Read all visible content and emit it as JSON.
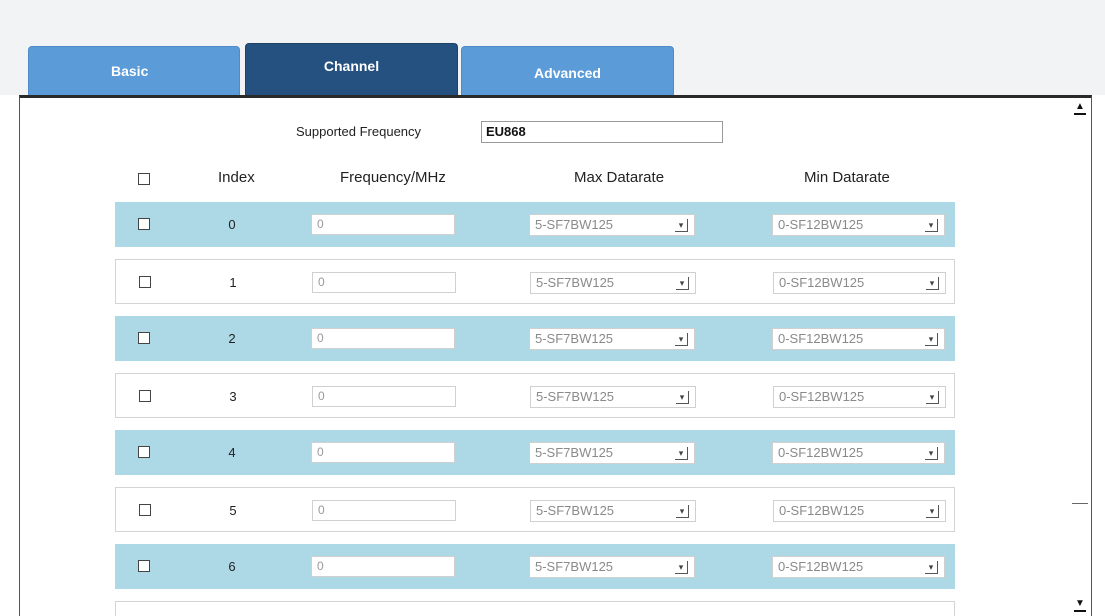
{
  "tabs": [
    {
      "label": "Basic"
    },
    {
      "label": "Channel"
    },
    {
      "label": "Advanced"
    }
  ],
  "supported_frequency": {
    "label": "Supported Frequency",
    "value": "EU868"
  },
  "table": {
    "headers": {
      "index": "Index",
      "frequency": "Frequency/MHz",
      "max": "Max Datarate",
      "min": "Min Datarate"
    },
    "rows": [
      {
        "index": "0",
        "frequency": "0",
        "max": "5-SF7BW125",
        "min": "0-SF12BW125"
      },
      {
        "index": "1",
        "frequency": "0",
        "max": "5-SF7BW125",
        "min": "0-SF12BW125"
      },
      {
        "index": "2",
        "frequency": "0",
        "max": "5-SF7BW125",
        "min": "0-SF12BW125"
      },
      {
        "index": "3",
        "frequency": "0",
        "max": "5-SF7BW125",
        "min": "0-SF12BW125"
      },
      {
        "index": "4",
        "frequency": "0",
        "max": "5-SF7BW125",
        "min": "0-SF12BW125"
      },
      {
        "index": "5",
        "frequency": "0",
        "max": "5-SF7BW125",
        "min": "0-SF12BW125"
      },
      {
        "index": "6",
        "frequency": "0",
        "max": "5-SF7BW125",
        "min": "0-SF12BW125"
      }
    ]
  },
  "colors": {
    "tab_inactive": "#5b9bd8",
    "tab_active": "#24517f",
    "row_shade": "#add8e6"
  },
  "icons": {
    "dropdown": "chevron-down-icon",
    "scroll_up": "scroll-up-icon",
    "scroll_down": "scroll-down-icon"
  }
}
